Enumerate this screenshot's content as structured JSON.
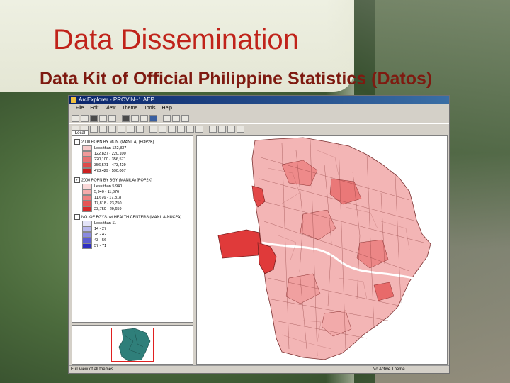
{
  "slide": {
    "title": "Data Dissemination",
    "subtitle": "Data Kit of Official Philippine Statistics (Datos)"
  },
  "app": {
    "window_title": "ArcExplorer - PROVIN~1.AEP",
    "menu": [
      "File",
      "Edit",
      "View",
      "Theme",
      "Tools",
      "Help"
    ],
    "toc_tab": "Local",
    "layers": [
      {
        "name": "2000 POPN BY MUN. (MANILA) [POP2K]",
        "checked": false,
        "classes": [
          {
            "label": "Less than 122,837",
            "color": "#f7c9c9"
          },
          {
            "label": "122,837 - 220,100",
            "color": "#f09a9a"
          },
          {
            "label": "220,100 - 356,571",
            "color": "#e87070"
          },
          {
            "label": "356,571 - 473,429",
            "color": "#de4a4a"
          },
          {
            "label": "473,429 - 590,007",
            "color": "#cc2020"
          }
        ]
      },
      {
        "name": "2000 POPN BY BGY (MANILA) [POP2K]",
        "checked": true,
        "classes": [
          {
            "label": "Less than 5,940",
            "color": "#fbd8d8"
          },
          {
            "label": "5,940 - 11,676",
            "color": "#f5abab"
          },
          {
            "label": "11,676 - 17,818",
            "color": "#ee8080"
          },
          {
            "label": "17,818 - 23,750",
            "color": "#e65454"
          },
          {
            "label": "23,750 - 29,659",
            "color": "#d62828"
          }
        ]
      },
      {
        "name": "NO. OF BGYS. w/ HEALTH CENTERS (MANILA-NUCPA)",
        "checked": false,
        "classes": [
          {
            "label": "Less than 11",
            "color": "#e4e4f8"
          },
          {
            "label": "14 - 27",
            "color": "#b8b8ee"
          },
          {
            "label": "28 - 42",
            "color": "#8a8ae0"
          },
          {
            "label": "43 - 56",
            "color": "#5c5cd2"
          },
          {
            "label": "57 - 71",
            "color": "#2e2ec0"
          }
        ]
      }
    ],
    "status_left": "Full View of all themes",
    "status_right": "No Active Theme"
  }
}
